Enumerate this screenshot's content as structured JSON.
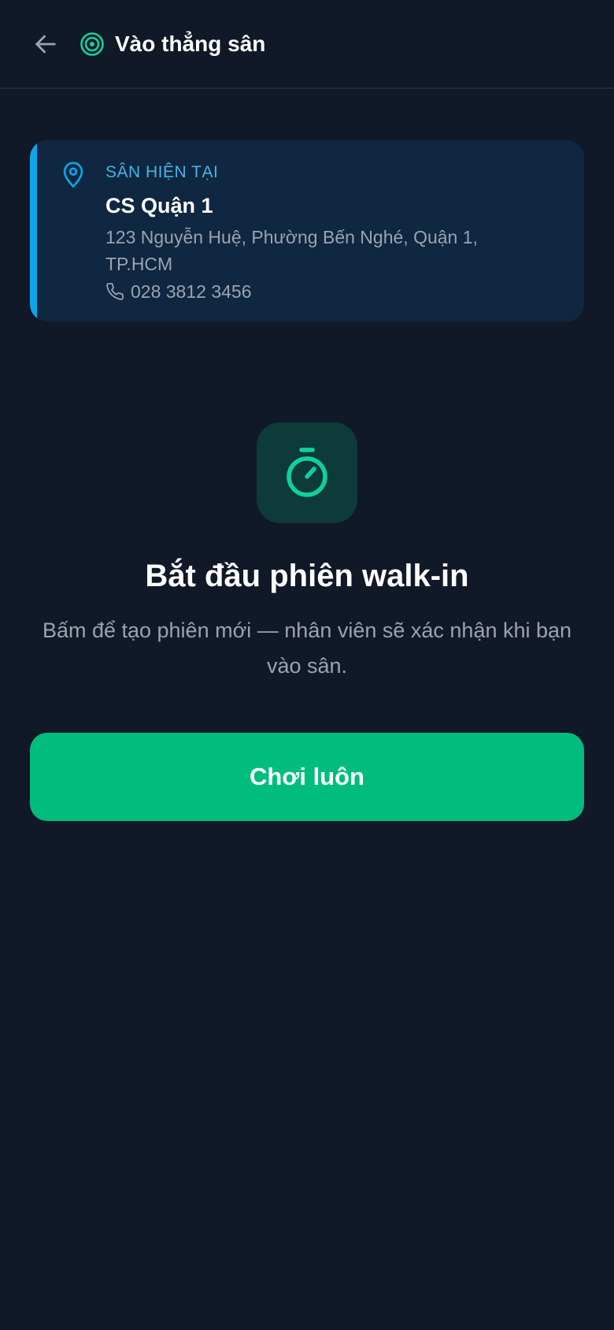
{
  "header": {
    "title": "Vào thẳng sân",
    "back_icon": "arrow-left-icon",
    "title_icon": "target-icon"
  },
  "location": {
    "label": "SÂN HIỆN TẠI",
    "name": "CS Quận 1",
    "address": "123 Nguyễn Huệ, Phường Bến Nghé, Quận 1, TP.HCM",
    "phone": "028 3812 3456",
    "pin_icon": "map-pin-icon",
    "phone_icon": "phone-icon"
  },
  "session": {
    "icon": "stopwatch-icon",
    "headline": "Bắt đầu phiên walk-in",
    "description": "Bấm để tạo phiên mới — nhân viên sẽ xác nhận khi bạn vào sân."
  },
  "actions": {
    "play_label": "Chơi luôn"
  },
  "colors": {
    "background": "#111827",
    "card": "#0f2740",
    "accent_blue": "#0ea5e9",
    "accent_green": "#10d19a",
    "button": "#00bd7e",
    "muted_text": "#9ca3af"
  }
}
